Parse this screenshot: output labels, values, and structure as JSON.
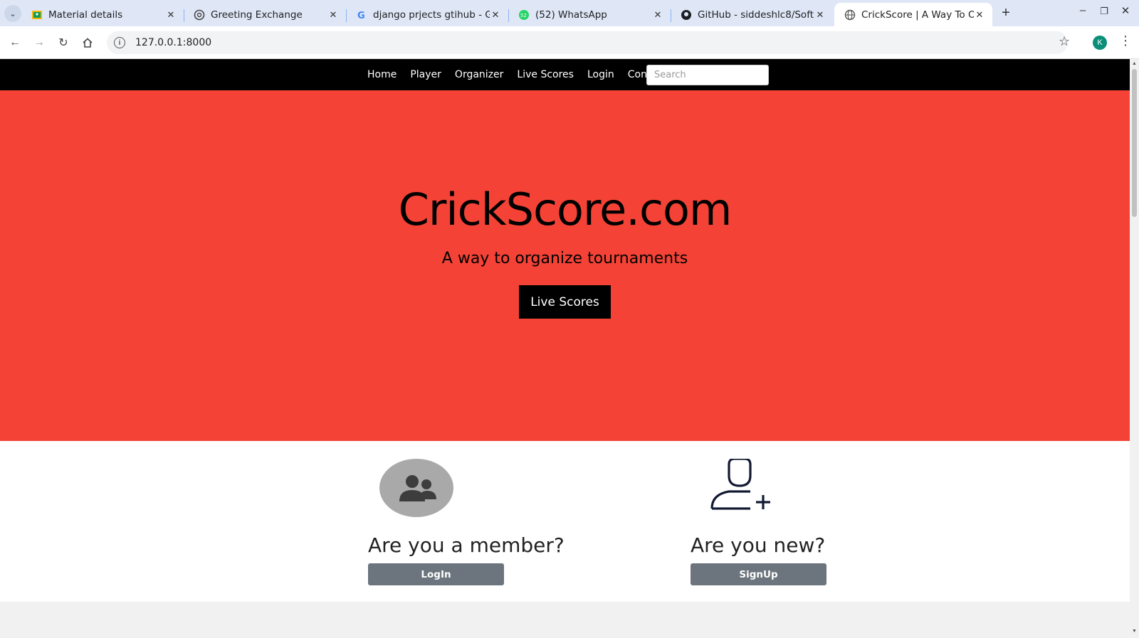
{
  "browser": {
    "tabs": [
      {
        "title": "Material details",
        "icon": "classroom-icon"
      },
      {
        "title": "Greeting Exchange",
        "icon": "chatgpt-icon"
      },
      {
        "title": "django prjects gtihub - G",
        "icon": "google-icon"
      },
      {
        "title": "(52) WhatsApp",
        "icon": "whatsapp-icon"
      },
      {
        "title": "GitHub - siddeshlc8/Soft",
        "icon": "github-icon"
      },
      {
        "title": "CrickScore | A Way To Or",
        "icon": "globe-icon"
      }
    ],
    "url": "127.0.0.1:8000",
    "profile_initial": "K"
  },
  "nav": {
    "links": [
      "Home",
      "Player",
      "Organizer",
      "Live Scores",
      "Login",
      "Contact"
    ],
    "search_placeholder": "Search"
  },
  "hero": {
    "title": "CrickScore.com",
    "tagline": "A way to organize tournaments",
    "button": "Live Scores",
    "background": "#f44336"
  },
  "cards": {
    "member": {
      "heading": "Are you a member?",
      "button": "LogIn"
    },
    "new": {
      "heading": "Are you new?",
      "button": "SignUp"
    }
  }
}
